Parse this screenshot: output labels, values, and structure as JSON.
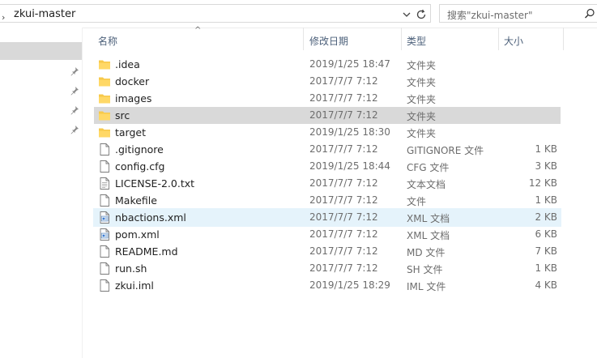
{
  "address": {
    "path": "zkui-master"
  },
  "search": {
    "placeholder": "搜索\"zkui-master\""
  },
  "columns": {
    "name": "名称",
    "date": "修改日期",
    "type": "类型",
    "size": "大小"
  },
  "files": [
    {
      "name": ".idea",
      "date": "2019/1/25 18:47",
      "type": "文件夹",
      "size": "",
      "icon": "folder-icon"
    },
    {
      "name": "docker",
      "date": "2017/7/7 7:12",
      "type": "文件夹",
      "size": "",
      "icon": "folder-icon"
    },
    {
      "name": "images",
      "date": "2017/7/7 7:12",
      "type": "文件夹",
      "size": "",
      "icon": "folder-icon"
    },
    {
      "name": "src",
      "date": "2017/7/7 7:12",
      "type": "文件夹",
      "size": "",
      "icon": "folder-icon"
    },
    {
      "name": "target",
      "date": "2019/1/25 18:30",
      "type": "文件夹",
      "size": "",
      "icon": "folder-icon"
    },
    {
      "name": ".gitignore",
      "date": "2017/7/7 7:12",
      "type": "GITIGNORE 文件",
      "size": "1 KB",
      "icon": "file-icon"
    },
    {
      "name": "config.cfg",
      "date": "2019/1/25 18:44",
      "type": "CFG 文件",
      "size": "3 KB",
      "icon": "file-icon"
    },
    {
      "name": "LICENSE-2.0.txt",
      "date": "2017/7/7 7:12",
      "type": "文本文档",
      "size": "12 KB",
      "icon": "text-file-icon"
    },
    {
      "name": "Makefile",
      "date": "2017/7/7 7:12",
      "type": "文件",
      "size": "1 KB",
      "icon": "file-icon"
    },
    {
      "name": "nbactions.xml",
      "date": "2017/7/7 7:12",
      "type": "XML 文档",
      "size": "2 KB",
      "icon": "xml-file-icon"
    },
    {
      "name": "pom.xml",
      "date": "2017/7/7 7:12",
      "type": "XML 文档",
      "size": "6 KB",
      "icon": "xml-file-icon"
    },
    {
      "name": "README.md",
      "date": "2017/7/7 7:12",
      "type": "MD 文件",
      "size": "7 KB",
      "icon": "file-icon"
    },
    {
      "name": "run.sh",
      "date": "2017/7/7 7:12",
      "type": "SH 文件",
      "size": "1 KB",
      "icon": "file-icon"
    },
    {
      "name": "zkui.iml",
      "date": "2019/1/25 18:29",
      "type": "IML 文件",
      "size": "4 KB",
      "icon": "file-icon"
    }
  ],
  "state": {
    "selected_file": "src",
    "hovered_file": "nbactions.xml"
  },
  "colors": {
    "folder": "#f7c94a",
    "selected_row": "#d9d9d9",
    "hover_row": "#e5f3fb",
    "header_text": "#4c607a"
  }
}
